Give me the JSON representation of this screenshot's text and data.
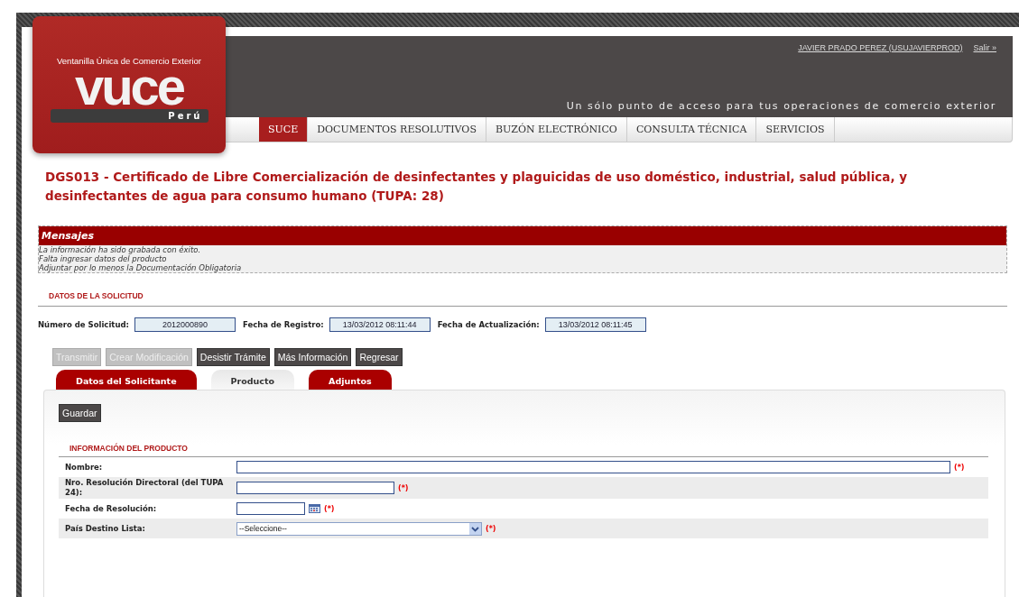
{
  "logo": {
    "tagline": "Ventanilla Única de Comercio Exterior",
    "wordmark": "vuce",
    "country": "Perú"
  },
  "header": {
    "user": "JAVIER PRADO PEREZ (USUJAVIERPROD)",
    "logout": "Salir »",
    "slogan": "Un sólo punto de acceso para tus operaciones de comercio exterior"
  },
  "nav": [
    {
      "label": "SUCE",
      "selected": true
    },
    {
      "label": "DOCUMENTOS RESOLUTIVOS",
      "selected": false
    },
    {
      "label": "BUZÓN ELECTRÓNICO",
      "selected": false
    },
    {
      "label": "CONSULTA TÉCNICA",
      "selected": false
    },
    {
      "label": "SERVICIOS",
      "selected": false
    }
  ],
  "page_title": "DGS013 - Certificado de Libre Comercialización de desinfectantes y plaguicidas de uso doméstico, industrial, salud pública, y desinfectantes de agua para consumo humano (TUPA: 28)",
  "messages": {
    "title": "Mensajes",
    "lines": [
      "La información ha sido grabada con éxito.",
      "Falta ingresar datos del producto",
      "Adjuntar por lo menos la Documentación Obligatoria"
    ]
  },
  "request": {
    "title": "DATOS DE LA SOLICITUD",
    "fields": [
      {
        "label": "Número de Solicitud:",
        "value": "2012000890"
      },
      {
        "label": "Fecha de Registro:",
        "value": "13/03/2012 08:11:44"
      },
      {
        "label": "Fecha de Actualización:",
        "value": "13/03/2012 08:11:45"
      }
    ]
  },
  "actions": [
    {
      "label": "Transmitir",
      "disabled": true
    },
    {
      "label": "Crear Modificación",
      "disabled": true
    },
    {
      "label": "Desistir Trámite",
      "disabled": false
    },
    {
      "label": "Más Información",
      "disabled": false
    },
    {
      "label": "Regresar",
      "disabled": false
    }
  ],
  "tabs": [
    {
      "label": "Datos del Solicitante",
      "selected": false
    },
    {
      "label": "Producto",
      "selected": true
    },
    {
      "label": "Adjuntos",
      "selected": false
    }
  ],
  "save_button": "Guardar",
  "product": {
    "title": "INFORMACIÓN DEL PRODUCTO",
    "fields": [
      {
        "kind": "longtext",
        "label": "Nombre:",
        "required": "(*)"
      },
      {
        "kind": "shorttext",
        "label": "Nro. Resolución Directoral (del TUPA 24):",
        "required": "(*)"
      },
      {
        "kind": "date",
        "label": "Fecha de Resolución:",
        "required": "(*)"
      },
      {
        "kind": "select",
        "label": "País Destino Lista:",
        "value": "--Seleccione--",
        "required": "(*)"
      }
    ]
  }
}
